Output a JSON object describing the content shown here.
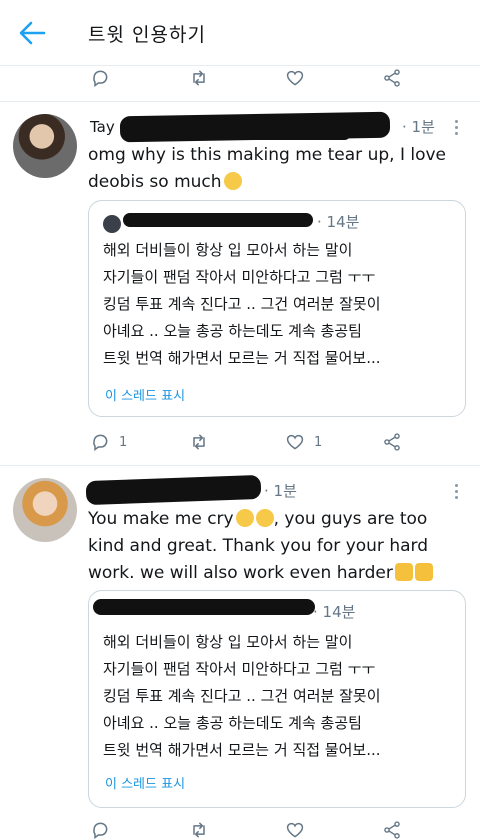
{
  "header": {
    "title": "트윗 인용하기"
  },
  "colors": {
    "accent": "#1da1f2",
    "muted": "#657786",
    "link": "#1b95e0",
    "border": "#ccd6dd"
  },
  "top_actions": {
    "icons": [
      "reply-icon",
      "retweet-icon",
      "like-icon",
      "share-icon"
    ]
  },
  "tweets": [
    {
      "name_visible": "Tay",
      "time": "1분",
      "text_line1": "omg why is this making me tear up, I love",
      "text_line2": "deobis so much",
      "emoji": "face-with-rolling-eyes",
      "quote": {
        "time": "14분",
        "text_lines": [
          "해외 더비들이 항상 입 모아서 하는 말이",
          "자기들이 팬덤 작아서 미안하다고 그럼 ㅜㅜ",
          "킹덤 투표 계속 진다고 .. 그건 여러분 잘못이",
          "아녜요 .. 오늘 총공 하는데도 계속 총공팀",
          "트윗 번역 해가면서 모르는 거 직접 물어보..."
        ],
        "link": "이 스레드 표시"
      },
      "actions": {
        "reply_count": "1",
        "retweet_count": "",
        "like_count": "1"
      }
    },
    {
      "time": "1분",
      "text_line1": "You make me cry",
      "text_line1b": ", you guys are too",
      "text_line2": "kind and great. Thank you for your hard",
      "text_line3": "work. we will also work even harder",
      "emoji_inline": "crying-face",
      "emoji_end": "flexed-biceps",
      "quote": {
        "time": "14분",
        "text_lines": [
          "해외 더비들이 항상 입 모아서 하는 말이",
          "자기들이 팬덤 작아서 미안하다고 그럼 ㅜㅜ",
          "킹덤 투표 계속 진다고 .. 그건 여러분 잘못이",
          "아녜요 .. 오늘 총공 하는데도 계속 총공팀",
          "트윗 번역 해가면서 모르는 거 직접 물어보..."
        ],
        "link": "이 스레드 표시"
      },
      "actions": {
        "reply_count": "",
        "retweet_count": "",
        "like_count": ""
      }
    }
  ]
}
